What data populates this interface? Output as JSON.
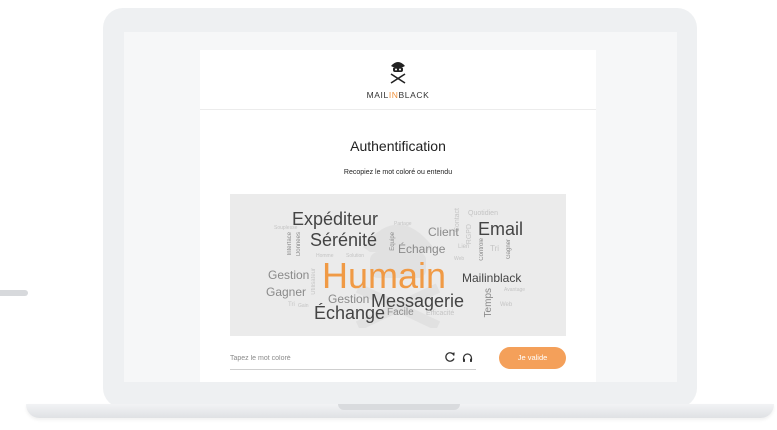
{
  "brand": {
    "pre": "MAIL",
    "mid": "IN",
    "post": "BLACK",
    "accent": "#f0913a"
  },
  "auth": {
    "title": "Authentification",
    "subtitle": "Recopiez le mot coloré ou entendu"
  },
  "captcha": {
    "highlighted_word": "Humain",
    "words": {
      "expediteur": "Expéditeur",
      "serenite": "Sérénité",
      "client": "Client",
      "email": "Email",
      "echange1": "Échange",
      "gestion1": "Gestion",
      "gagner1": "Gagner",
      "mailinblack": "Mailinblack",
      "gestion2": "Gestion",
      "messagerie": "Messagerie",
      "echange2": "Échange",
      "facile": "Facile",
      "efficacite": "Efficacité",
      "temps": "Temps",
      "interface": "Interface",
      "donnees": "Données",
      "equipe": "Équipe",
      "rgpd": "RGPD",
      "controle": "Contrôle",
      "gagner2": "Gagner",
      "contact": "Contact",
      "quotidien": "Quotidien",
      "souplesse": "Souplesse",
      "partage": "Partage",
      "homme": "Homme",
      "solution": "Solution",
      "tri1": "Tri",
      "tri2": "Tri",
      "web1": "Web",
      "web2": "Web",
      "avantage": "Avantage",
      "utilisateur": "Utilisateur",
      "lien": "Lien",
      "gain": "Gain"
    }
  },
  "form": {
    "placeholder": "Tapez le mot coloré",
    "value": "",
    "submit_label": "Je valide"
  },
  "icons": {
    "refresh": "refresh-icon",
    "audio": "headphones-icon"
  },
  "colors": {
    "accent": "#f0913a",
    "button": "#f4a05a"
  }
}
